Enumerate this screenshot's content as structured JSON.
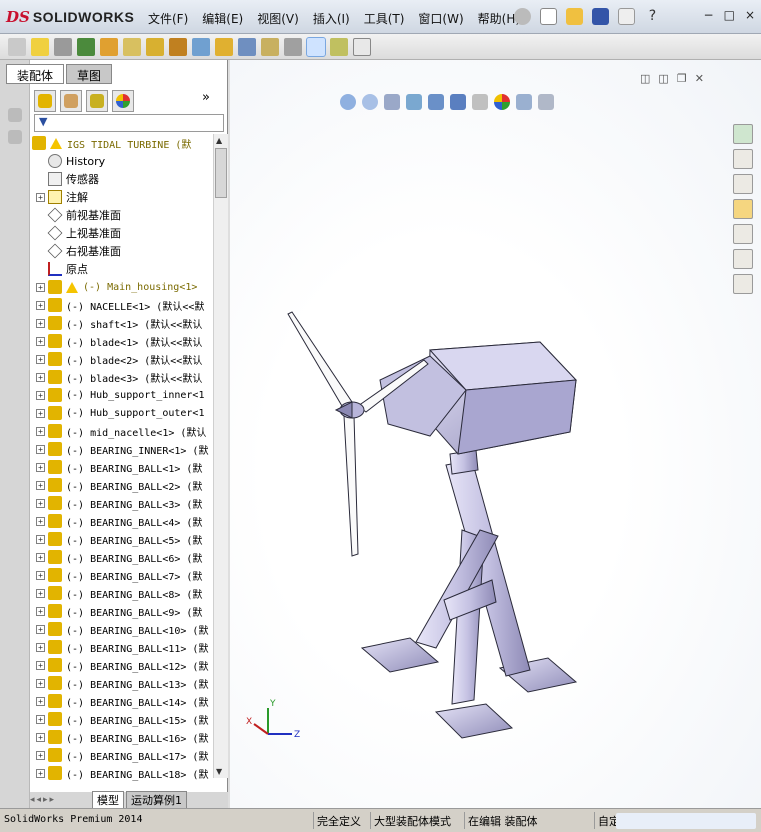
{
  "app": {
    "title": "SOLIDWORKS",
    "brand_prefix": "DS",
    "menus": [
      "文件(F)",
      "编辑(E)",
      "视图(V)",
      "插入(I)",
      "工具(T)",
      "窗口(W)",
      "帮助(H)"
    ],
    "window_buttons": [
      "−",
      "□",
      "×"
    ]
  },
  "panel": {
    "tabs": [
      "装配体",
      "草图"
    ],
    "bottom_tabs": [
      "模型",
      "运动算例1"
    ],
    "expand_chevron": "»"
  },
  "tree": {
    "root": "IGS  TIDAL TURBINE  (默",
    "items": [
      {
        "label": "History",
        "icon": "history-icon",
        "expandable": false
      },
      {
        "label": "传感器",
        "icon": "sensor-icon",
        "expandable": false
      },
      {
        "label": "注解",
        "icon": "annotation-icon",
        "expandable": true
      },
      {
        "label": "前视基准面",
        "icon": "plane-icon",
        "expandable": false
      },
      {
        "label": "上视基准面",
        "icon": "plane-icon",
        "expandable": false
      },
      {
        "label": "右视基准面",
        "icon": "plane-icon",
        "expandable": false
      },
      {
        "label": "原点",
        "icon": "origin-icon",
        "expandable": false
      },
      {
        "label": "(-) Main_housing<1>",
        "icon": "part-warning-icon",
        "expandable": true,
        "warning": true
      },
      {
        "label": "(-) NACELLE<1> (默认<<默",
        "icon": "part-icon",
        "expandable": true
      },
      {
        "label": "(-) shaft<1> (默认<<默认",
        "icon": "part-icon",
        "expandable": true
      },
      {
        "label": "(-) blade<1> (默认<<默认",
        "icon": "part-icon",
        "expandable": true
      },
      {
        "label": "(-) blade<2> (默认<<默认",
        "icon": "part-icon",
        "expandable": true
      },
      {
        "label": "(-) blade<3> (默认<<默认",
        "icon": "part-icon",
        "expandable": true
      },
      {
        "label": "(-) Hub_support_inner<1",
        "icon": "part-icon",
        "expandable": true
      },
      {
        "label": "(-) Hub_support_outer<1",
        "icon": "part-icon",
        "expandable": true
      },
      {
        "label": "(-) mid_nacelle<1> (默认",
        "icon": "part-icon",
        "expandable": true
      },
      {
        "label": "(-) BEARING_INNER<1> (默",
        "icon": "part-icon",
        "expandable": true
      },
      {
        "label": "(-) BEARING_BALL<1> (默",
        "icon": "part-icon",
        "expandable": true
      },
      {
        "label": "(-) BEARING_BALL<2> (默",
        "icon": "part-icon",
        "expandable": true
      },
      {
        "label": "(-) BEARING_BALL<3> (默",
        "icon": "part-icon",
        "expandable": true
      },
      {
        "label": "(-) BEARING_BALL<4> (默",
        "icon": "part-icon",
        "expandable": true
      },
      {
        "label": "(-) BEARING_BALL<5> (默",
        "icon": "part-icon",
        "expandable": true
      },
      {
        "label": "(-) BEARING_BALL<6> (默",
        "icon": "part-icon",
        "expandable": true
      },
      {
        "label": "(-) BEARING_BALL<7> (默",
        "icon": "part-icon",
        "expandable": true
      },
      {
        "label": "(-) BEARING_BALL<8> (默",
        "icon": "part-icon",
        "expandable": true
      },
      {
        "label": "(-) BEARING_BALL<9> (默",
        "icon": "part-icon",
        "expandable": true
      },
      {
        "label": "(-) BEARING_BALL<10> (默",
        "icon": "part-icon",
        "expandable": true
      },
      {
        "label": "(-) BEARING_BALL<11> (默",
        "icon": "part-icon",
        "expandable": true
      },
      {
        "label": "(-) BEARING_BALL<12> (默",
        "icon": "part-icon",
        "expandable": true
      },
      {
        "label": "(-) BEARING_BALL<13> (默",
        "icon": "part-icon",
        "expandable": true
      },
      {
        "label": "(-) BEARING_BALL<14> (默",
        "icon": "part-icon",
        "expandable": true
      },
      {
        "label": "(-) BEARING_BALL<15> (默",
        "icon": "part-icon",
        "expandable": true
      },
      {
        "label": "(-) BEARING_BALL<16> (默",
        "icon": "part-icon",
        "expandable": true
      },
      {
        "label": "(-) BEARING_BALL<17> (默",
        "icon": "part-icon",
        "expandable": true
      },
      {
        "label": "(-) BEARING_BALL<18> (默",
        "icon": "part-icon",
        "expandable": true
      }
    ]
  },
  "status": {
    "app_name": "SolidWorks Premium 2014",
    "segments": [
      "完全定义",
      "大型装配体模式",
      "在编辑 装配体",
      "自定义"
    ]
  },
  "colors": {
    "accent": "#3a6fc4",
    "part_icon": "#e2b400",
    "warning": "#f5c400",
    "model_body": "#c9c6e8",
    "model_edge": "#2a2a3a"
  }
}
